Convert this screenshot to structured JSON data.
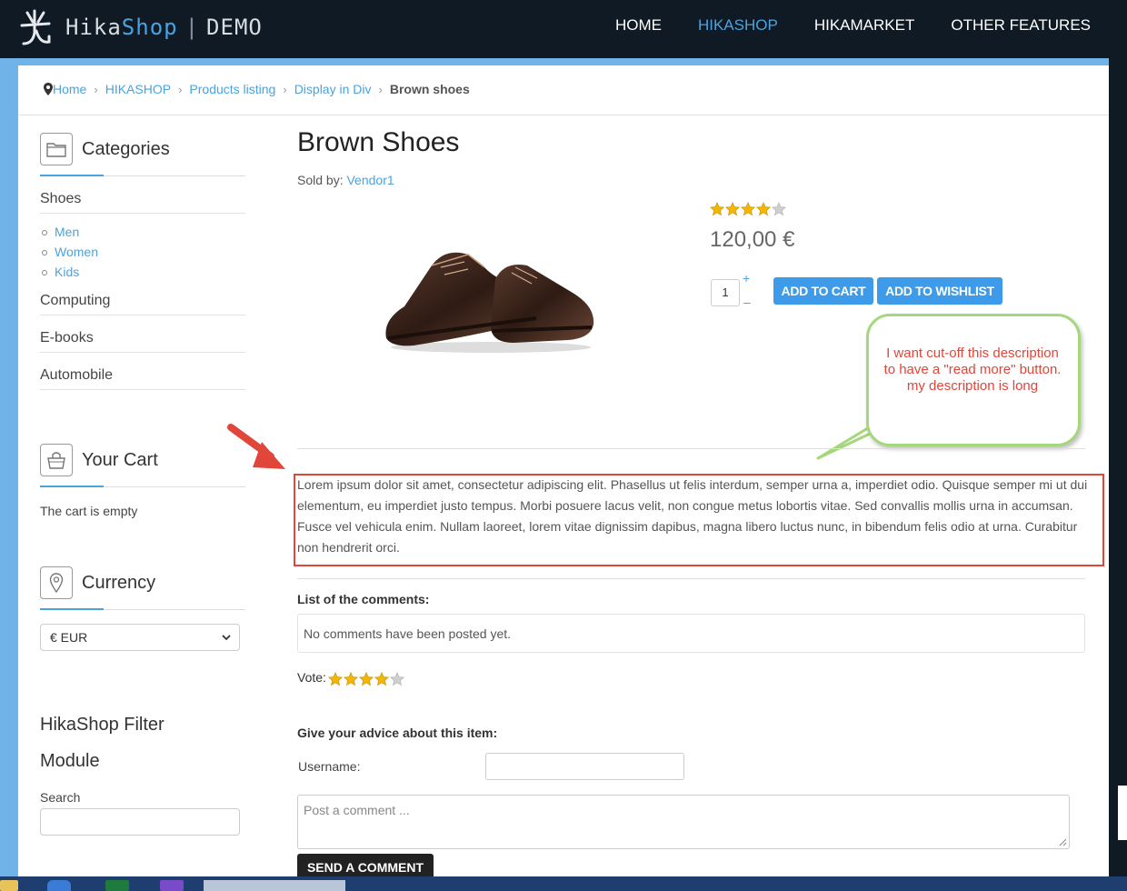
{
  "brand": {
    "hika": "Hika",
    "shop": "Shop",
    "sep": "|",
    "demo": "DEMO"
  },
  "nav": {
    "home": "HOME",
    "hikashop": "HIKASHOP",
    "hikamarket": "HIKAMARKET",
    "other": "OTHER FEATURES"
  },
  "breadcrumb": {
    "home": "Home",
    "hikashop": "HIKASHOP",
    "listing": "Products listing",
    "display": "Display in Div",
    "current": "Brown shoes"
  },
  "sidebar": {
    "categories_title": "Categories",
    "categories": [
      "Shoes",
      "Computing",
      "E-books",
      "Automobile"
    ],
    "subcategories": [
      "Men",
      "Women",
      "Kids"
    ],
    "cart_title": "Your Cart",
    "cart_empty": "The cart is empty",
    "currency_title": "Currency",
    "currency_value": "€ EUR",
    "filter_title_line1": "HikaShop Filter",
    "filter_title_line2": "Module",
    "search_label": "Search"
  },
  "product": {
    "title": "Brown Shoes",
    "sold_by": "Sold by:",
    "vendor": "Vendor1",
    "rating": 4,
    "rating_max": 5,
    "price": "120,00 €",
    "quantity": "1",
    "qty_plus": "+",
    "qty_minus": "–",
    "add_to_cart": "ADD TO CART",
    "add_to_wishlist": "ADD TO WISHLIST",
    "description": "Lorem ipsum dolor sit amet, consectetur adipiscing elit. Phasellus ut felis interdum, semper urna a, imperdiet odio. Quisque semper mi ut dui elementum, eu imperdiet justo tempus. Morbi posuere lacus velit, non congue metus lobortis vitae. Sed convallis mollis urna in accumsan. Fusce vel vehicula enim. Nullam laoreet, lorem vitae dignissim dapibus, magna libero luctus nunc, in bibendum felis odio at urna. Curabitur non hendrerit orci."
  },
  "annotation": {
    "callout": "I want cut-off this description to have a \"read more\" button. my description is long"
  },
  "comments": {
    "title": "List of the comments:",
    "empty": "No comments have been posted yet.",
    "vote_label": "Vote:",
    "vote_rating": 4,
    "advice_title": "Give your advice about this item:",
    "username_label": "Username:",
    "comment_placeholder": "Post a comment ...",
    "send_button": "SEND A COMMENT"
  },
  "colors": {
    "accent": "#4aa3df",
    "button": "#3d9be9",
    "annotation_red": "#e0463a",
    "callout_green": "#a5d77c",
    "nav_bg": "#0f1a24"
  }
}
